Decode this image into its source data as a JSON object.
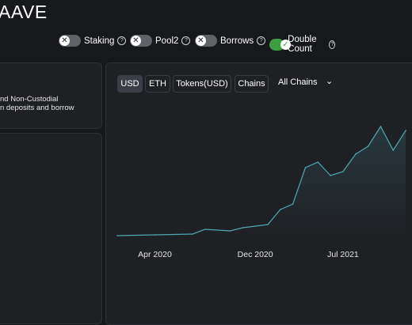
{
  "header": {
    "title": "AAVE"
  },
  "toggles": [
    {
      "label": "Staking",
      "on": false,
      "icon": "x-icon"
    },
    {
      "label": "Pool2",
      "on": false,
      "icon": "x-icon"
    },
    {
      "label": "Borrows",
      "on": false,
      "icon": "x-icon"
    },
    {
      "label": "Double Count",
      "on": true,
      "icon": "check-icon"
    }
  ],
  "description": {
    "line1": "nd Non-Custodial",
    "line2": "n deposits and borrow"
  },
  "chart_controls": {
    "buttons": [
      "USD",
      "ETH",
      "Tokens(USD)",
      "Chains"
    ],
    "active": "USD",
    "chain_select": "All Chains"
  },
  "colors": {
    "background": "#17181c",
    "card": "#1f2024",
    "line": "#4ea8b3",
    "toggle_on": "#3b9f3e",
    "toggle_off": "#5f6267"
  },
  "chart_data": {
    "type": "area",
    "title": "",
    "xlabel": "",
    "ylabel": "",
    "x_ticks": [
      "Apr 2020",
      "Dec 2020",
      "Jul 2021"
    ],
    "grid": false,
    "series": [
      {
        "values": [
          {
            "x": "2020-01",
            "y": 2
          },
          {
            "x": "2020-04",
            "y": 3
          },
          {
            "x": "2020-07",
            "y": 4
          },
          {
            "x": "2020-08",
            "y": 10
          },
          {
            "x": "2020-10",
            "y": 8
          },
          {
            "x": "2020-11",
            "y": 12
          },
          {
            "x": "2021-01",
            "y": 16
          },
          {
            "x": "2021-02",
            "y": 35
          },
          {
            "x": "2021-03",
            "y": 42
          },
          {
            "x": "2021-04",
            "y": 88
          },
          {
            "x": "2021-05",
            "y": 95
          },
          {
            "x": "2021-06",
            "y": 78
          },
          {
            "x": "2021-07",
            "y": 83
          },
          {
            "x": "2021-08",
            "y": 105
          },
          {
            "x": "2021-09",
            "y": 115
          },
          {
            "x": "2021-10",
            "y": 140
          },
          {
            "x": "2021-11",
            "y": 110
          },
          {
            "x": "2021-12",
            "y": 135
          }
        ]
      }
    ]
  }
}
